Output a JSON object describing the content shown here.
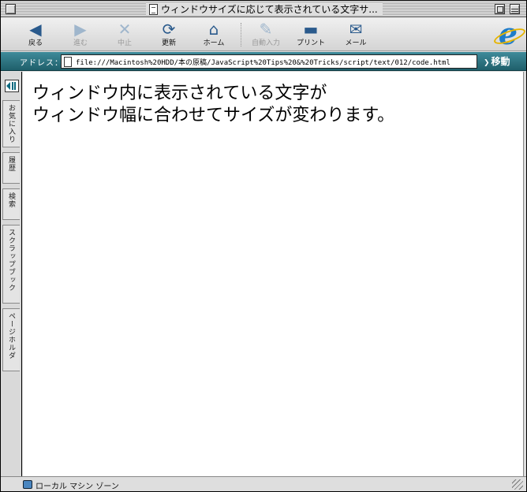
{
  "window": {
    "title": "ウィンドウサイズに応じて表示されている文字サ..."
  },
  "toolbar": {
    "buttons": [
      {
        "label": "戻る",
        "icon": "back-arrow-icon",
        "enabled": true
      },
      {
        "label": "進む",
        "icon": "forward-arrow-icon",
        "enabled": false
      },
      {
        "label": "中止",
        "icon": "stop-x-icon",
        "enabled": false
      },
      {
        "label": "更新",
        "icon": "refresh-icon",
        "enabled": true
      },
      {
        "label": "ホーム",
        "icon": "home-icon",
        "enabled": true
      },
      {
        "label": "自動入力",
        "icon": "autofill-pen-icon",
        "enabled": false
      },
      {
        "label": "プリント",
        "icon": "printer-icon",
        "enabled": true
      },
      {
        "label": "メール",
        "icon": "mail-icon",
        "enabled": true
      }
    ],
    "accent_color": "#2a5a8c"
  },
  "address_bar": {
    "label": "アドレス：",
    "url": "file:///Macintosh%20HDD/本の原稿/JavaScript%20Tips%20&%20Tricks/script/text/012/code.html",
    "go_label": "移動",
    "bar_color": "#2f7482"
  },
  "sidebar": {
    "tabs": [
      "お気に入り",
      "履歴",
      "検索",
      "スクラップブック",
      "ページホルダ"
    ]
  },
  "content": {
    "lines": [
      "ウィンドウ内に表示されている文字が",
      "ウィンドウ幅に合わせてサイズが変わります。"
    ]
  },
  "status": {
    "zone_text": "ローカル マシン ゾーン"
  }
}
